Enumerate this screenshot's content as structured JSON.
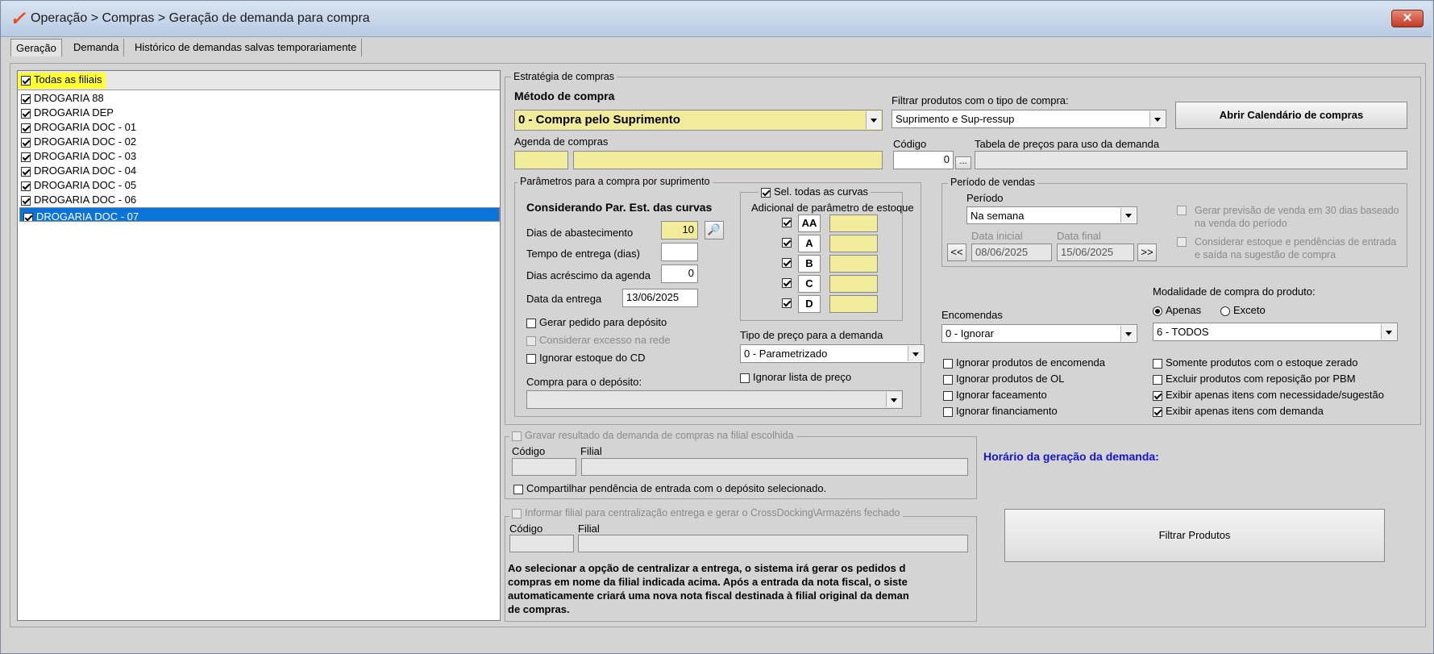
{
  "window": {
    "title": "Operação > Compras > Geração de demanda para compra",
    "close_label": "✕"
  },
  "tabs": [
    {
      "label": "Geração"
    },
    {
      "label": "Demanda"
    },
    {
      "label": "Histórico de demandas salvas temporariamente"
    }
  ],
  "filiais": {
    "all_label": "Todas as filiais",
    "items": [
      "DROGARIA 88",
      "DROGARIA DEP",
      "DROGARIA DOC - 01",
      "DROGARIA DOC - 02",
      "DROGARIA DOC - 03",
      "DROGARIA DOC - 04",
      "DROGARIA DOC - 05",
      "DROGARIA DOC - 06",
      "DROGARIA DOC - 07"
    ]
  },
  "estrategia": {
    "legend": "Estratégia de compras",
    "metodo_label": "Método de compra",
    "metodo_value": "0 - Compra pelo Suprimento",
    "filtrar_label": "Filtrar produtos com o tipo de compra:",
    "filtrar_value": "Suprimento e Sup-ressup",
    "calendario_btn": "Abrir Calendário de compras",
    "agenda_label": "Agenda de compras",
    "codigo_label": "Código",
    "codigo_value": "0",
    "ellipsis": "...",
    "tabela_label": "Tabela de preços para uso da demanda"
  },
  "suprimento": {
    "legend": "Parâmetros para a compra por suprimento",
    "considerando": "Considerando Par. Est. das curvas",
    "dias_abast_label": "Dias de abastecimento",
    "dias_abast_value": "10",
    "tempo_entrega_label": "Tempo de entrega (dias)",
    "dias_acrescimo_label": "Dias acréscimo da agenda",
    "dias_acrescimo_value": "0",
    "data_entrega_label": "Data da entrega",
    "data_entrega_value": "13/06/2025",
    "gerar_pedido": "Gerar pedido para depósito",
    "considerar_excesso": "Considerar excesso na rede",
    "ignorar_estoque_cd": "Ignorar estoque do CD",
    "compra_deposito_label": "Compra para o depósito:",
    "curvas_legend": "Sel. todas as curvas",
    "adicional_label": "Adicional de parâmetro de estoque",
    "curvas": [
      "AA",
      "A",
      "B",
      "C",
      "D"
    ],
    "tipo_preco_label": "Tipo de preço para a demanda",
    "tipo_preco_value": "0 - Parametrizado",
    "ignorar_lista": "Ignorar lista de preço"
  },
  "periodo": {
    "legend": "Período de vendas",
    "periodo_label": "Período",
    "periodo_value": "Na semana",
    "data_inicial_label": "Data inicial",
    "data_inicial_value": "08/06/2025",
    "data_final_label": "Data final",
    "data_final_value": "15/06/2025",
    "prev_btn": "<<",
    "next_btn": ">>",
    "gerar_previsao": "Gerar previsão de venda em 30 dias baseado na venda do período",
    "considerar_estoque": "Considerar estoque e pendências de entrada e saída na sugestão de compra"
  },
  "encomendas": {
    "label": "Encomendas",
    "value": "0 - Ignorar",
    "modalidade_label": "Modalidade de compra do produto:",
    "apenas": "Apenas",
    "exceto": "Exceto",
    "modalidade_value": "6 - TODOS",
    "checks_left": [
      "Ignorar produtos de encomenda",
      "Ignorar produtos de OL",
      "Ignorar faceamento",
      "Ignorar financiamento"
    ],
    "checks_right": [
      "Somente produtos com o estoque zerado",
      "Excluir produtos com reposição por PBM",
      "Exibir apenas itens com necessidade/sugestão",
      "Exibir apenas itens com demanda"
    ]
  },
  "gravar": {
    "legend": "Gravar resultado da demanda de compras na filial escolhida",
    "codigo_label": "Código",
    "filial_label": "Filial",
    "compartilhar": "Compartilhar pendência de entrada com o depósito selecionado."
  },
  "centralizar": {
    "legend": "Informar filial para centralização entrega e gerar o CrossDocking\\Armazéns fechado",
    "codigo_label": "Código",
    "filial_label": "Filial",
    "info_lines": [
      "Ao selecionar a opção de centralizar a entrega, o sistema irá gerar os pedidos d",
      "compras em nome da filial indicada acima. Após a entrada da nota fiscal, o siste",
      "automaticamente criará uma nova nota fiscal destinada à filial original da deman",
      "de compras."
    ]
  },
  "horario_label": "Horário da geração da demanda:",
  "filtrar_btn": "Filtrar Produtos"
}
